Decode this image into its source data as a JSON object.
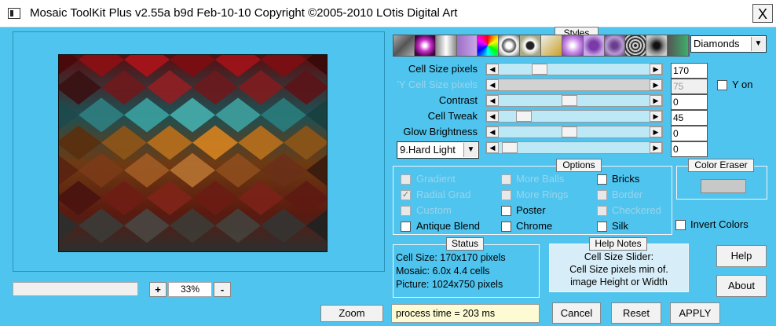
{
  "window": {
    "title": "Mosaic ToolKit Plus  v2.55a b9d Feb-10-10  Copyright ©2005-2010 LOtis Digital Art",
    "close_glyph": "X"
  },
  "zoom": {
    "minus": "-",
    "plus": "+",
    "value": "33%",
    "button": "Zoom"
  },
  "styles": {
    "label": "Styles",
    "selected": "Diamonds"
  },
  "sliders": [
    {
      "label": "Cell Size pixels",
      "value": "170",
      "disabled": false
    },
    {
      "label": "'Y Cell Size pixels",
      "value": "75",
      "disabled": true
    },
    {
      "label": "Contrast",
      "value": "0",
      "disabled": false
    },
    {
      "label": "Cell Tweak",
      "value": "45",
      "disabled": false
    },
    {
      "label": "Glow Brightness",
      "value": "0",
      "disabled": false
    }
  ],
  "blend_mode": {
    "selected": "9.Hard Light",
    "value": "0"
  },
  "y_on": {
    "label": "Y on"
  },
  "options": {
    "label": "Options",
    "col1": [
      {
        "label": "Gradient",
        "checked": false,
        "disabled": true
      },
      {
        "label": "Radial Grad",
        "checked": true,
        "disabled": true
      },
      {
        "label": "Custom",
        "checked": false,
        "disabled": true
      },
      {
        "label": "Antique Blend",
        "checked": false,
        "disabled": false
      }
    ],
    "col2": [
      {
        "label": "More Balls",
        "checked": false,
        "disabled": true
      },
      {
        "label": "More Rings",
        "checked": false,
        "disabled": true
      },
      {
        "label": "Poster",
        "checked": false,
        "disabled": false
      },
      {
        "label": "Chrome",
        "checked": false,
        "disabled": false
      }
    ],
    "col3": [
      {
        "label": "Bricks",
        "checked": false,
        "disabled": false
      },
      {
        "label": "Border",
        "checked": false,
        "disabled": true
      },
      {
        "label": "Checkered",
        "checked": false,
        "disabled": true
      },
      {
        "label": "Silk",
        "checked": false,
        "disabled": false
      }
    ],
    "invert": {
      "label": "Invert Colors",
      "checked": false
    }
  },
  "color_eraser": {
    "label": "Color Eraser"
  },
  "status": {
    "label": "Status",
    "cell_size": "Cell Size: 170x170 pixels",
    "mosaic": "Mosaic:  6.0x  4.4 cells",
    "picture": "Picture: 1024x750 pixels"
  },
  "help_notes": {
    "label": "Help Notes",
    "line1": "Cell Size Slider:",
    "line2": "Cell Size pixels min of.",
    "line3": "image Height or Width"
  },
  "process": {
    "text": "process time = 203 ms"
  },
  "buttons": {
    "help": "Help",
    "about": "About",
    "cancel": "Cancel",
    "reset": "Reset",
    "apply": "APPLY"
  }
}
